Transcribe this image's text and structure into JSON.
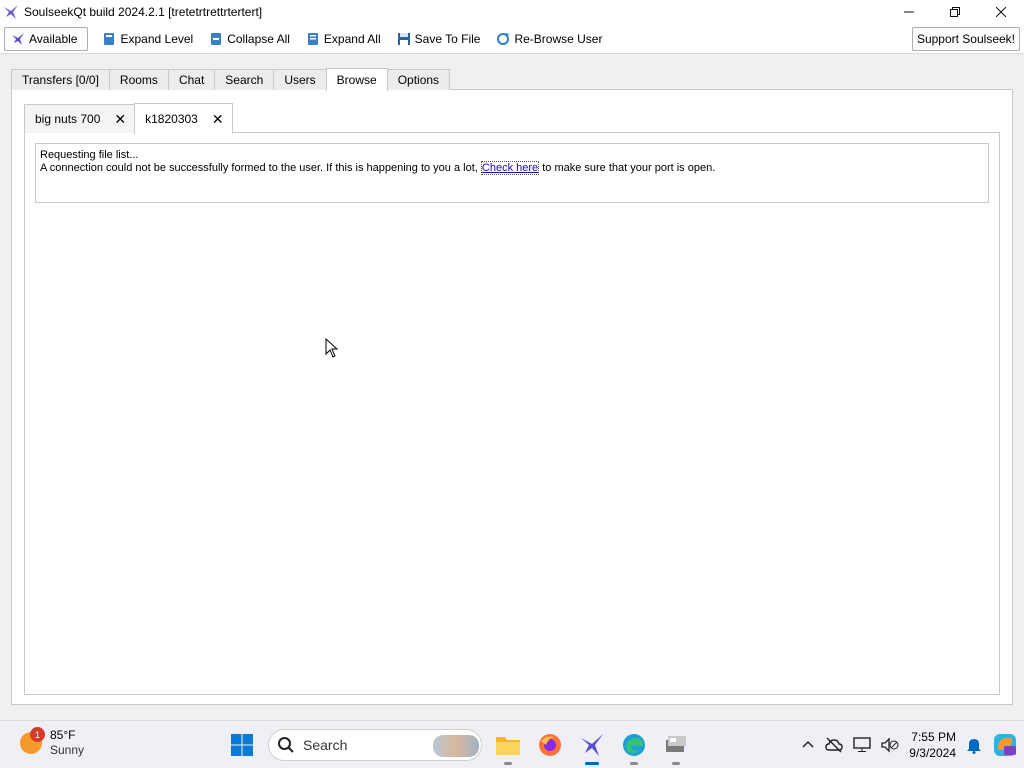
{
  "window": {
    "title": "SoulseekQt build 2024.2.1 [tretetrtrettrtertert]",
    "controls": [
      "minimize",
      "restore",
      "close"
    ]
  },
  "toolbar": {
    "status_label": "Available",
    "expand_level": "Expand Level",
    "collapse_all": "Collapse All",
    "expand_all": "Expand All",
    "save_to_file": "Save To File",
    "rebrowse_user": "Re-Browse User",
    "support": "Support Soulseek!"
  },
  "main_tabs": [
    {
      "label": "Transfers [0/0]"
    },
    {
      "label": "Rooms"
    },
    {
      "label": "Chat"
    },
    {
      "label": "Search"
    },
    {
      "label": "Users"
    },
    {
      "label": "Browse",
      "active": true
    },
    {
      "label": "Options"
    }
  ],
  "browse_tabs": [
    {
      "label": "big nuts 700"
    },
    {
      "label": "k1820303",
      "active": true
    }
  ],
  "message": {
    "line1": "Requesting file list...",
    "line2_before": "A connection could not be successfully formed to the user. If this is happening to you a lot, ",
    "link": "Check here",
    "line2_after": " to make sure that your port is open."
  },
  "taskbar": {
    "weather_badge": "1",
    "temperature": "85°F",
    "condition": "Sunny",
    "search_placeholder": "Search",
    "time": "7:55 PM",
    "date": "9/3/2024"
  },
  "colors": {
    "accent": "#0067c0",
    "link": "#1a0dab",
    "badge": "#d63a2a"
  }
}
